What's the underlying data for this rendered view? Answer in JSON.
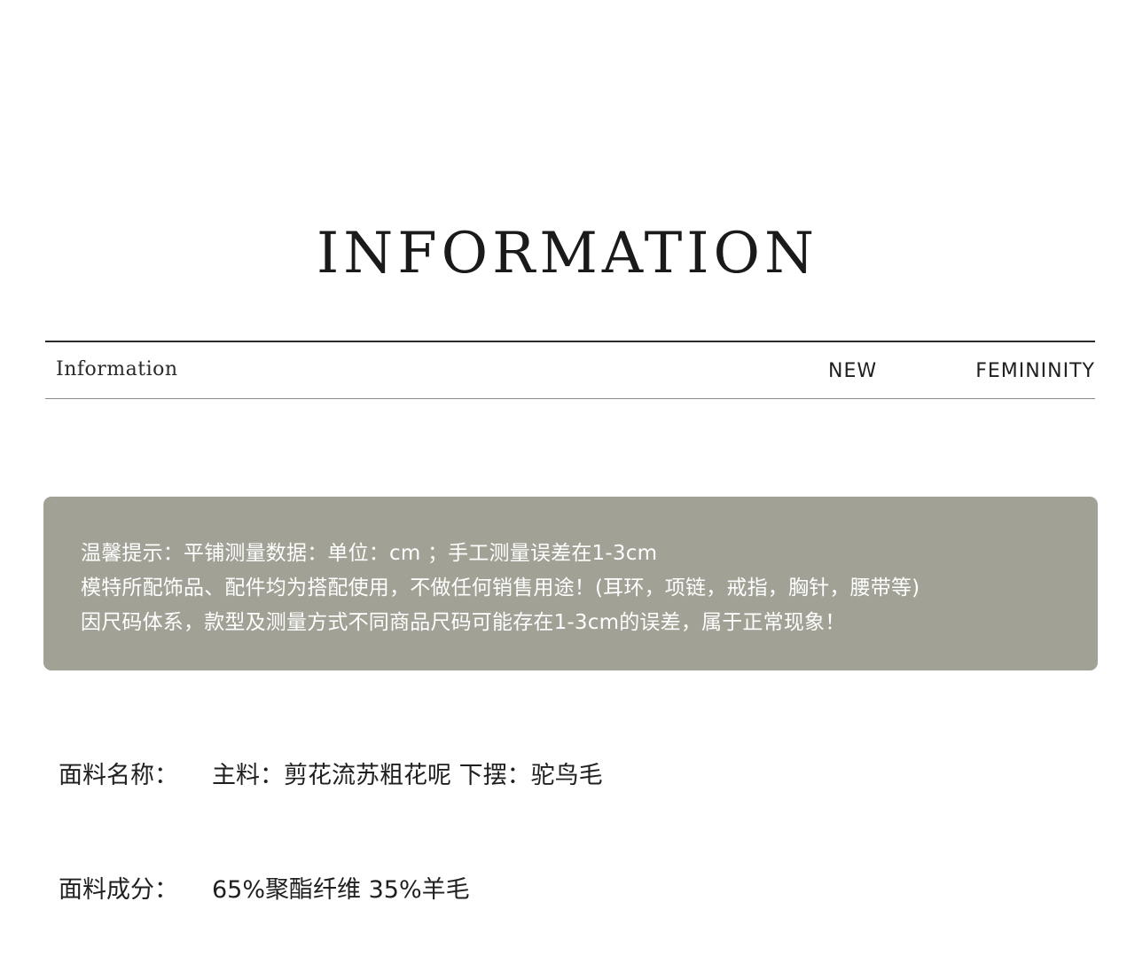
{
  "header": {
    "title": "INFORMATION"
  },
  "bar": {
    "left": "Information",
    "middle": "NEW",
    "right": "FEMININITY"
  },
  "notice": {
    "line1": "温馨提示：平铺测量数据：单位：cm ；手工测量误差在1-3cm",
    "line2": "模特所配饰品、配件均为搭配使用，不做任何销售用途！(耳环，项链，戒指，胸针，腰带等)",
    "line3": "因尺码体系，款型及测量方式不同商品尺码可能存在1-3cm的误差，属于正常现象！"
  },
  "details": [
    {
      "label": "面料名称：",
      "value": "主料：剪花流苏粗花呢 下摆：驼鸟毛"
    },
    {
      "label": "面料成分：",
      "value": "65%聚酯纤维 35%羊毛"
    }
  ],
  "colors": {
    "notice_background": "#a1a195",
    "notice_text": "#ffffff",
    "text": "#1f1f1f"
  }
}
